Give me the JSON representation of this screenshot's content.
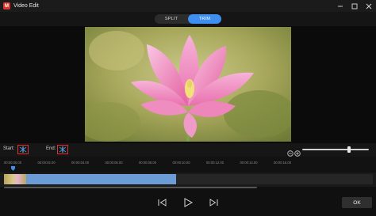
{
  "window": {
    "title": "Video Edit",
    "app_icon_glyph": "M",
    "controls": [
      "minimize-icon",
      "maximize-icon",
      "close-icon"
    ]
  },
  "mode_tabs": {
    "split_label": "SPLIT",
    "trim_label": "TRIM",
    "active": "TRIM"
  },
  "trim_controls": {
    "start_label": "Start:",
    "end_label": "End:"
  },
  "zoom": {
    "level": 0.7
  },
  "timeline": {
    "ticks": [
      "00:00:00.00",
      "00:00:02.00",
      "00:00:04.00",
      "00:00:06.00",
      "00:00:08.00",
      "00:00:10.00",
      "00:00:12.00",
      "00:00:14.00",
      "00:00:16.00"
    ]
  },
  "playback": {
    "ok_label": "OK"
  },
  "colors": {
    "accent": "#3f8ff0",
    "marker_red": "#e23030",
    "clip_blue": "#6b9cd6"
  }
}
